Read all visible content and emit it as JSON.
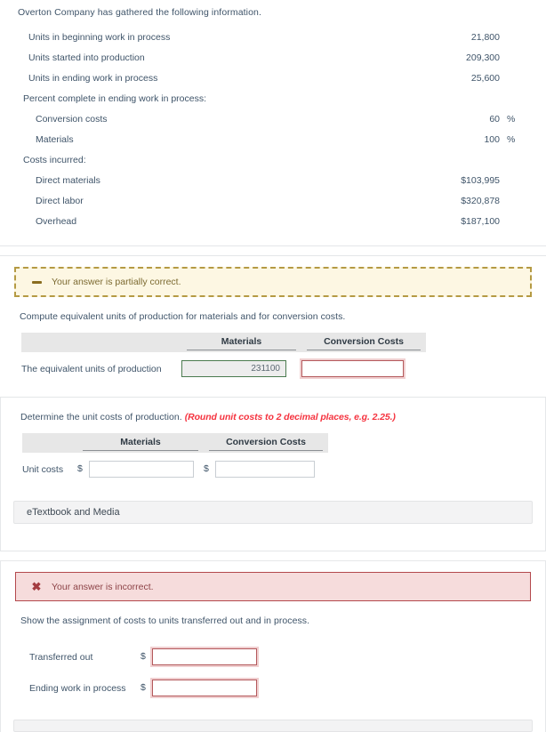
{
  "intro": {
    "title": "Overton Company has gathered the following information.",
    "rows": [
      {
        "label": "Units in beginning work in process",
        "value": "21,800",
        "unit": "",
        "indent": "normal"
      },
      {
        "label": "Units started into production",
        "value": "209,300",
        "unit": "",
        "indent": "normal"
      },
      {
        "label": "Units in ending work in process",
        "value": "25,600",
        "unit": "",
        "indent": "normal"
      },
      {
        "label": "Percent complete in ending work in process:",
        "value": "",
        "unit": "",
        "indent": "flush"
      },
      {
        "label": "Conversion costs",
        "value": "60",
        "unit": "%",
        "indent": "sub"
      },
      {
        "label": "Materials",
        "value": "100",
        "unit": "%",
        "indent": "sub"
      },
      {
        "label": "Costs incurred:",
        "value": "",
        "unit": "",
        "indent": "flush"
      },
      {
        "label": "Direct materials",
        "value": "$103,995",
        "unit": "",
        "indent": "sub"
      },
      {
        "label": "Direct labor",
        "value": "$320,878",
        "unit": "",
        "indent": "sub"
      },
      {
        "label": "Overhead",
        "value": "$187,100",
        "unit": "",
        "indent": "sub"
      }
    ]
  },
  "partial_alert": {
    "icon": "minus-icon",
    "message": "Your answer is partially correct.",
    "border_color": "#b59a43",
    "background_color": "#fdf7e3",
    "text_color": "#7c6a31"
  },
  "equivalent_units": {
    "instruction": "Compute equivalent units of production for materials and for conversion costs.",
    "headers": [
      "",
      "Materials",
      "Conversion Costs"
    ],
    "row_label": "The equivalent units of production",
    "materials_value": "231100",
    "materials_state": "correct",
    "conversion_value": "",
    "conversion_state": "incorrect",
    "correct_border_color": "#4b7b4f",
    "incorrect_border_color": "#b4595c"
  },
  "unit_costs": {
    "instruction_main": "Determine the unit costs of production.",
    "instruction_hint": "(Round unit costs to 2 decimal places, e.g. 2.25.)",
    "hint_color": "#f5333f",
    "headers": [
      "",
      "Materials",
      "Conversion Costs"
    ],
    "row_label": "Unit costs",
    "currency_symbol": "$",
    "materials_value": "",
    "conversion_value": ""
  },
  "etextbook": {
    "label": "eTextbook and Media"
  },
  "incorrect_alert": {
    "icon": "x-icon",
    "message": "Your answer is incorrect.",
    "border_color": "#b3484c",
    "background_color": "#f6dcdc",
    "text_color": "#8d4347"
  },
  "cost_assignment": {
    "instruction": "Show the assignment of costs to units transferred out and in process.",
    "currency_symbol": "$",
    "rows": [
      {
        "label": "Transferred out",
        "value": "",
        "state": "incorrect"
      },
      {
        "label": "Ending work in process",
        "value": "",
        "state": "incorrect"
      }
    ]
  }
}
